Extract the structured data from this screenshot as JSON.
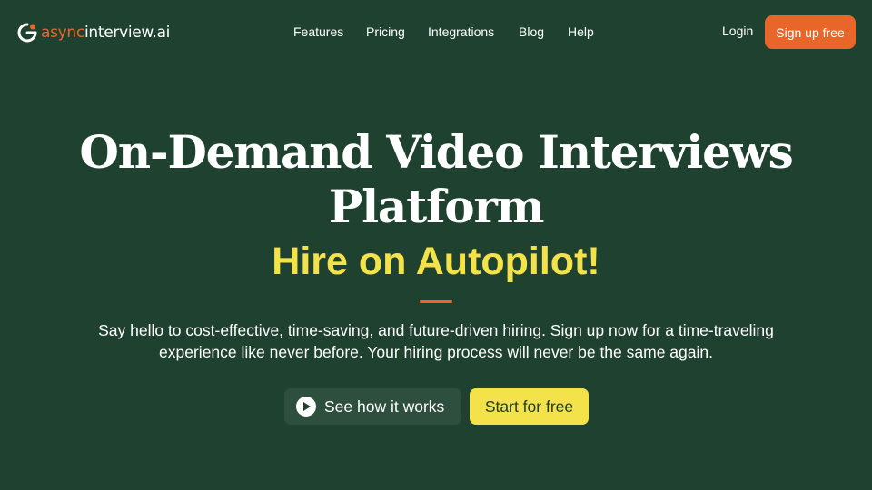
{
  "brand": {
    "name_accent": "async",
    "name_rest": "interview.ai",
    "accent_color": "#e8662a",
    "highlight_color": "#f3e24a",
    "background_color": "#1f4230"
  },
  "nav": {
    "items": [
      {
        "label": "Features"
      },
      {
        "label": "Pricing"
      },
      {
        "label": "Integrations"
      },
      {
        "label": "Blog"
      },
      {
        "label": "Help"
      }
    ],
    "login_label": "Login",
    "signup_label": "Sign up free"
  },
  "hero": {
    "title_line1": "On-Demand Video Interviews",
    "title_line2": "Platform",
    "subtitle": "Hire on Autopilot!",
    "description_line1": "Say hello to cost-effective, time-saving, and future-driven hiring. Sign up now for a time-traveling",
    "description_line2": "experience like never before. Your hiring process will never be the same again.",
    "cta_secondary": {
      "label": "See how it works",
      "icon": "play-icon"
    },
    "cta_primary": {
      "label": "Start for free"
    }
  }
}
